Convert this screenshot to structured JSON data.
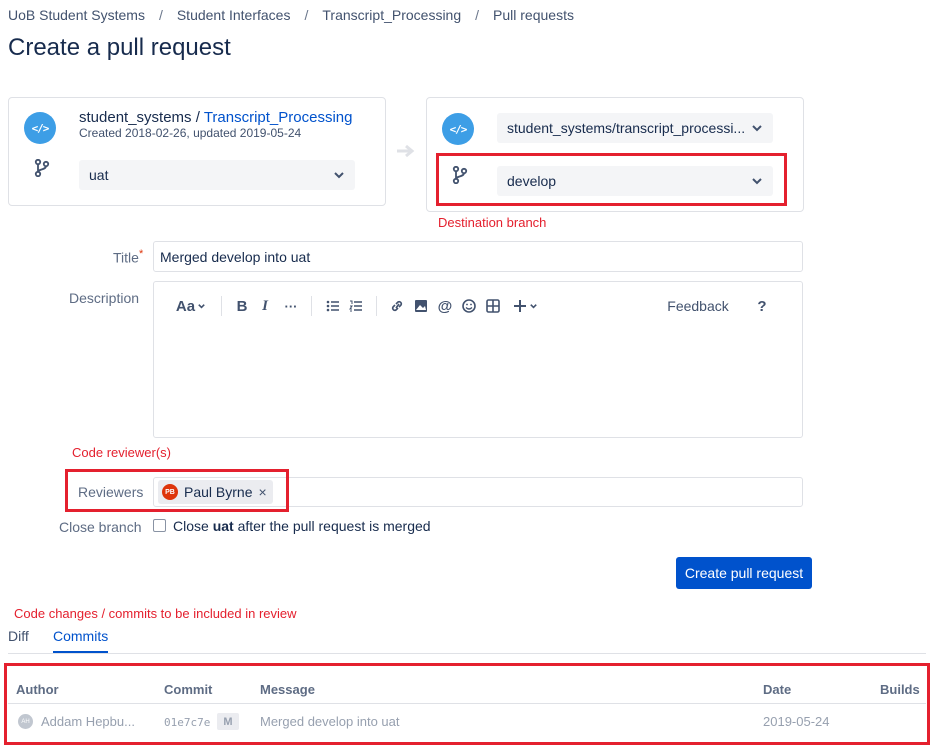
{
  "breadcrumb": [
    "UoB Student Systems",
    "Student Interfaces",
    "Transcript_Processing",
    "Pull requests"
  ],
  "page_title": "Create a pull request",
  "source": {
    "project": "student_systems",
    "separator": "/",
    "repo": "Transcript_Processing",
    "meta": "Created 2018-02-26, updated 2019-05-24",
    "branch": "uat"
  },
  "destination": {
    "repo": "student_systems/transcript_processi...",
    "branch": "develop"
  },
  "annotations": {
    "destination_branch": "Destination branch",
    "code_reviewers": "Code reviewer(s)",
    "code_changes": "Code changes / commits to be included in review"
  },
  "form": {
    "title_label": "Title",
    "required_mark": "*",
    "title_value": "Merged develop into uat",
    "description_label": "Description",
    "editor_toolbar": {
      "text_style": "Aa",
      "feedback": "Feedback",
      "help": "?"
    },
    "reviewers_label": "Reviewers",
    "reviewer": {
      "initials": "PB",
      "name": "Paul Byrne",
      "remove": "×"
    },
    "close_branch_label": "Close branch",
    "close_branch_prefix": "Close",
    "close_branch_name": "uat",
    "close_branch_suffix": "after the pull request is merged",
    "submit": "Create pull request"
  },
  "tabs": [
    {
      "label": "Diff",
      "active": false
    },
    {
      "label": "Commits",
      "active": true
    }
  ],
  "commits_table": {
    "columns": [
      "Author",
      "Commit",
      "Message",
      "Date",
      "Builds"
    ],
    "rows": [
      {
        "author_initials": "AH",
        "author": "Addam Hepbu...",
        "commit": "01e7c7e",
        "badge": "M",
        "message": "Merged develop into uat",
        "date": "2019-05-24",
        "builds": ""
      }
    ]
  },
  "colors": {
    "accent": "#0052cc",
    "annotation": "#e4202e",
    "repo_icon": "#3d9ee6"
  }
}
